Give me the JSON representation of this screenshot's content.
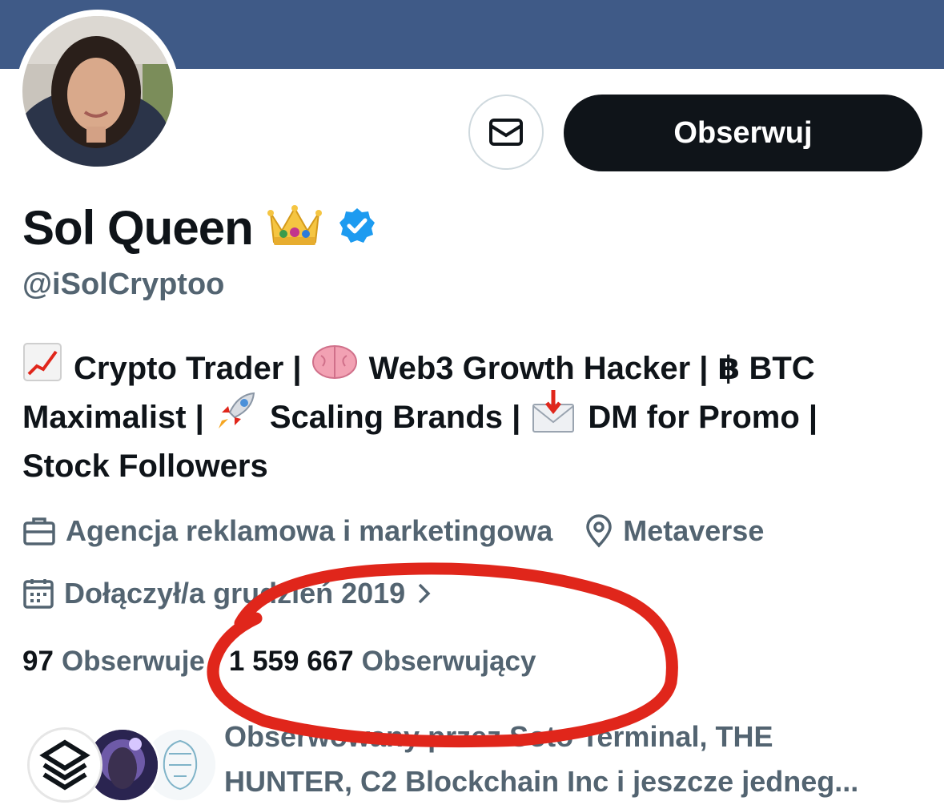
{
  "profile": {
    "display_name": "Sol Queen",
    "handle": "@iSolCryptoo",
    "follow_label": "Obserwuj"
  },
  "bio": {
    "line1_a": "Crypto Trader |",
    "line1_b": "Web3 Growth Hacker |",
    "line1_c": "฿ BTC",
    "line2_a": "Maximalist |",
    "line2_b": "Scaling Brands |",
    "line2_c": "DM for Promo |",
    "line3": "Stock Followers"
  },
  "meta": {
    "category": "Agencja reklamowa i marketingowa",
    "location": "Metaverse",
    "joined": "Dołączył/a grudzień 2019"
  },
  "stats": {
    "following_count": "97",
    "following_label": "Obserwuje",
    "followers_count": "1 559 667",
    "followers_label": "Obserwujący"
  },
  "followed_by": {
    "line1": "Obserwowany przez Soto Terminal, THE",
    "line2": "HUNTER, C2 Blockchain Inc i jeszcze jedneg..."
  },
  "colors": {
    "banner": "#3f5a87",
    "verified": "#1d9bf0",
    "muted": "#536471",
    "annotation": "#e0261b"
  }
}
